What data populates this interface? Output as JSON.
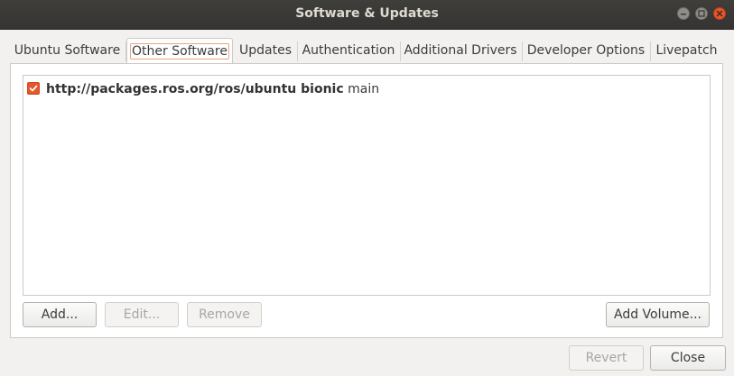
{
  "window": {
    "title": "Software & Updates"
  },
  "tabs": [
    {
      "label": "Ubuntu Software"
    },
    {
      "label": "Other Software",
      "active": true
    },
    {
      "label": "Updates"
    },
    {
      "label": "Authentication"
    },
    {
      "label": "Additional Drivers"
    },
    {
      "label": "Developer Options"
    },
    {
      "label": "Livepatch"
    }
  ],
  "sources": [
    {
      "checked": true,
      "url": "http://packages.ros.org/ros/ubuntu bionic",
      "components": "main"
    }
  ],
  "actions": {
    "add": "Add...",
    "edit": "Edit...",
    "remove": "Remove",
    "add_volume": "Add Volume..."
  },
  "footer": {
    "revert": "Revert",
    "close": "Close"
  },
  "colors": {
    "accent": "#e4572a",
    "titlebar": "#3c3b37"
  }
}
